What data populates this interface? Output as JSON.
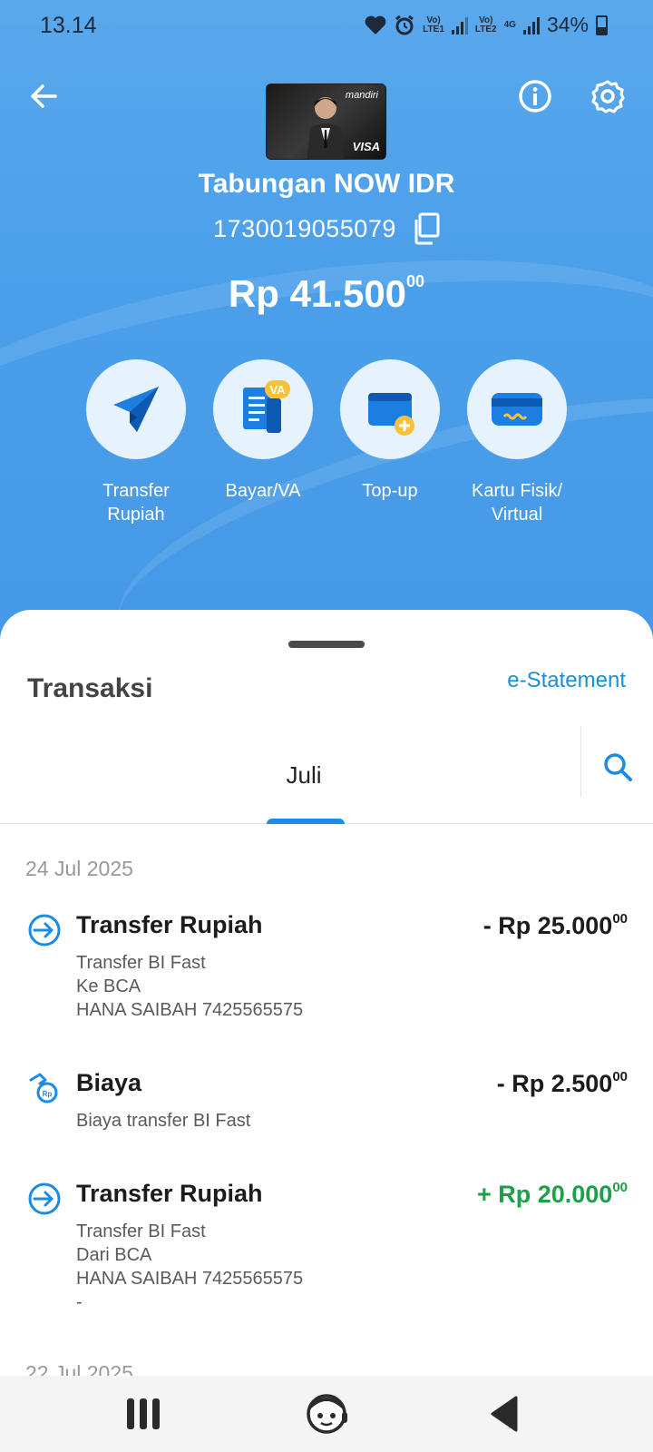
{
  "status_bar": {
    "time": "13.14",
    "sim1": "Vo)\nLTE1",
    "sim2": "Vo)\nLTE2",
    "network": "4G",
    "battery": "34%"
  },
  "header": {
    "card_brand": "mandiri",
    "card_network": "VISA"
  },
  "account": {
    "name": "Tabungan NOW IDR",
    "number": "1730019055079"
  },
  "balance": {
    "main": "Rp 41.500",
    "cents": "00"
  },
  "actions": [
    {
      "label": "Transfer\nRupiah",
      "icon": "paper-plane-icon"
    },
    {
      "label": "Bayar/VA",
      "icon": "document-va-icon",
      "badge": "VA"
    },
    {
      "label": "Top-up",
      "icon": "wallet-plus-icon"
    },
    {
      "label": "Kartu Fisik/\nVirtual",
      "icon": "card-icon"
    }
  ],
  "transactions": {
    "title": "Transaksi",
    "estatement": "e-Statement",
    "month": "Juli",
    "groups": [
      {
        "date": "24 Jul 2025",
        "items": [
          {
            "title": "Transfer Rupiah",
            "lines": [
              "Transfer BI Fast",
              "Ke BCA",
              "HANA SAIBAH 7425565575"
            ],
            "amount": "- Rp 25.000",
            "cents": "00",
            "type": "debit",
            "icon": "transfer-icon"
          },
          {
            "title": "Biaya",
            "lines": [
              "Biaya transfer BI Fast"
            ],
            "amount": "- Rp 2.500",
            "cents": "00",
            "type": "debit",
            "icon": "fee-icon"
          },
          {
            "title": "Transfer Rupiah",
            "lines": [
              "Transfer BI Fast",
              "Dari BCA",
              "HANA SAIBAH 7425565575",
              "-"
            ],
            "amount": "+ Rp 20.000",
            "cents": "00",
            "type": "credit",
            "icon": "transfer-icon"
          }
        ]
      },
      {
        "date": "22 Jul 2025",
        "items": []
      }
    ]
  },
  "colors": {
    "accent": "#1a8be6",
    "credit": "#1aa14a",
    "hero": "#4a9fea"
  }
}
